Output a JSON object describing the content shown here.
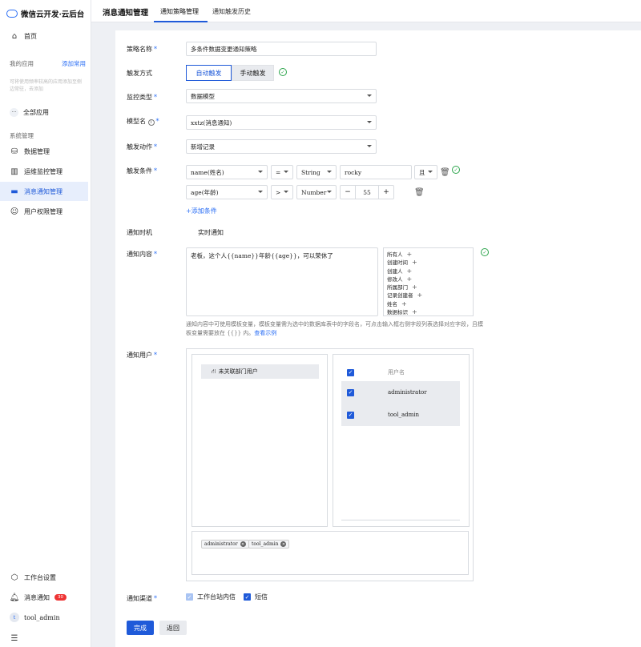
{
  "app": {
    "title": "微信云开发·云后台"
  },
  "sidebar": {
    "home": "首页",
    "my_apps": "我的应用",
    "add_common": "添加常用",
    "hint": "可将使用频率较高的应用添加至侧边常驻，去添加",
    "all_apps": "全部应用",
    "system_section": "系统管理",
    "items": [
      {
        "label": "数据管理"
      },
      {
        "label": "运维监控管理"
      },
      {
        "label": "消息通知管理"
      },
      {
        "label": "用户权限管理"
      }
    ],
    "bottom": {
      "workbench": "工作台设置",
      "notifications": "消息通知",
      "notification_count": "30",
      "user": "tool_admin",
      "user_initial": "t"
    }
  },
  "header": {
    "title": "消息通知管理",
    "tabs": [
      {
        "label": "通知策略管理"
      },
      {
        "label": "通知触发历史"
      }
    ]
  },
  "form": {
    "policy_name": {
      "label": "策略名称",
      "value": "多条件数据变更通知策略"
    },
    "trigger_mode": {
      "label": "触发方式",
      "options": [
        "自动触发",
        "手动触发"
      ]
    },
    "monitor_type": {
      "label": "监控类型",
      "value": "数据模型"
    },
    "model_name": {
      "label": "模型名",
      "value": "xxtz(消息通知)"
    },
    "trigger_action": {
      "label": "触发动作",
      "value": "新增记录"
    },
    "trigger_conditions": {
      "label": "触发条件",
      "rows": [
        {
          "field": "name(姓名)",
          "op": "=",
          "type": "String",
          "value": "rocky",
          "logic": "且"
        },
        {
          "field": "age(年龄)",
          "op": ">",
          "type": "Number",
          "value": "55"
        }
      ],
      "add_label": "+添加条件",
      "minus": "−",
      "plus": "+"
    },
    "notify_timing": {
      "label": "通知时机",
      "value": "实时通知"
    },
    "notify_content": {
      "label": "通知内容",
      "value": "老板，这个人{{name}}年龄{{age}}，可以荣休了",
      "variables": [
        "所有人",
        "创建时间",
        "创建人",
        "修改人",
        "所属部门",
        "记录创建者",
        "姓名",
        "数据标识"
      ],
      "hint": "通知内容中可使用模板变量，模板变量需为选中的数据库表中的字段名，可点击输入框右侧字段列表选择对应字段，且模板变量需要放在 {{}} 内。",
      "hint_link": "查看示例"
    },
    "notify_users": {
      "label": "通知用户",
      "dept": "未关联部门用户",
      "column": "用户名",
      "users": [
        "administrator",
        "tool_admin"
      ],
      "selected": [
        "administrator",
        "tool_admin"
      ]
    },
    "channels": {
      "label": "通知渠道",
      "options": [
        "工作台站内信",
        "短信"
      ]
    },
    "actions": {
      "done": "完成",
      "back": "返回"
    }
  },
  "colors": {
    "accent": "#1f5ad9",
    "success": "#2aa44a",
    "badge": "#e33333"
  }
}
